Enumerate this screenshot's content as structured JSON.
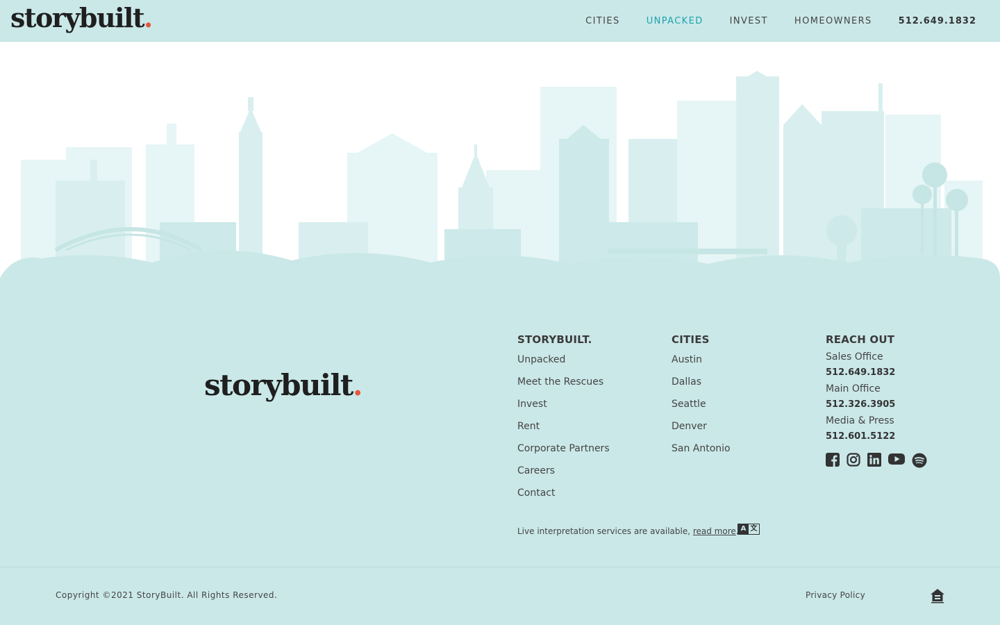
{
  "brand": {
    "name": "storybuilt",
    "dot": "."
  },
  "nav": {
    "items": [
      "CITIES",
      "UNPACKED",
      "INVEST",
      "HOMEOWNERS"
    ],
    "active": "UNPACKED",
    "phone": "512.649.1832"
  },
  "footer": {
    "col1": {
      "title": "STORYBUILT.",
      "links": [
        "Unpacked",
        "Meet the Rescues",
        "Invest",
        "Rent",
        "Corporate Partners",
        "Careers",
        "Contact"
      ]
    },
    "col2": {
      "title": "CITIES",
      "links": [
        "Austin",
        "Dallas",
        "Seattle",
        "Denver",
        "San Antonio"
      ]
    },
    "col3": {
      "title": "REACH OUT",
      "contacts": [
        {
          "label": "Sales Office",
          "number": "512.649.1832"
        },
        {
          "label": "Main Office",
          "number": "512.326.3905"
        },
        {
          "label": "Media & Press",
          "number": "512.601.5122"
        }
      ],
      "socials": [
        "facebook-icon",
        "instagram-icon",
        "linkedin-icon",
        "youtube-icon",
        "spotify-icon"
      ]
    },
    "interpretation": {
      "text": "Live interpretation services are available, ",
      "link": "read more",
      "tail": "."
    },
    "lang_badge": {
      "left": "A",
      "right": "文"
    },
    "copyright": "Copyright ©2021 StoryBuilt. All Rights Reserved.",
    "privacy": "Privacy Policy"
  },
  "colors": {
    "accent": "#1aa3ad",
    "brand_dot": "#e4573a",
    "band": "#cbe8e8"
  }
}
